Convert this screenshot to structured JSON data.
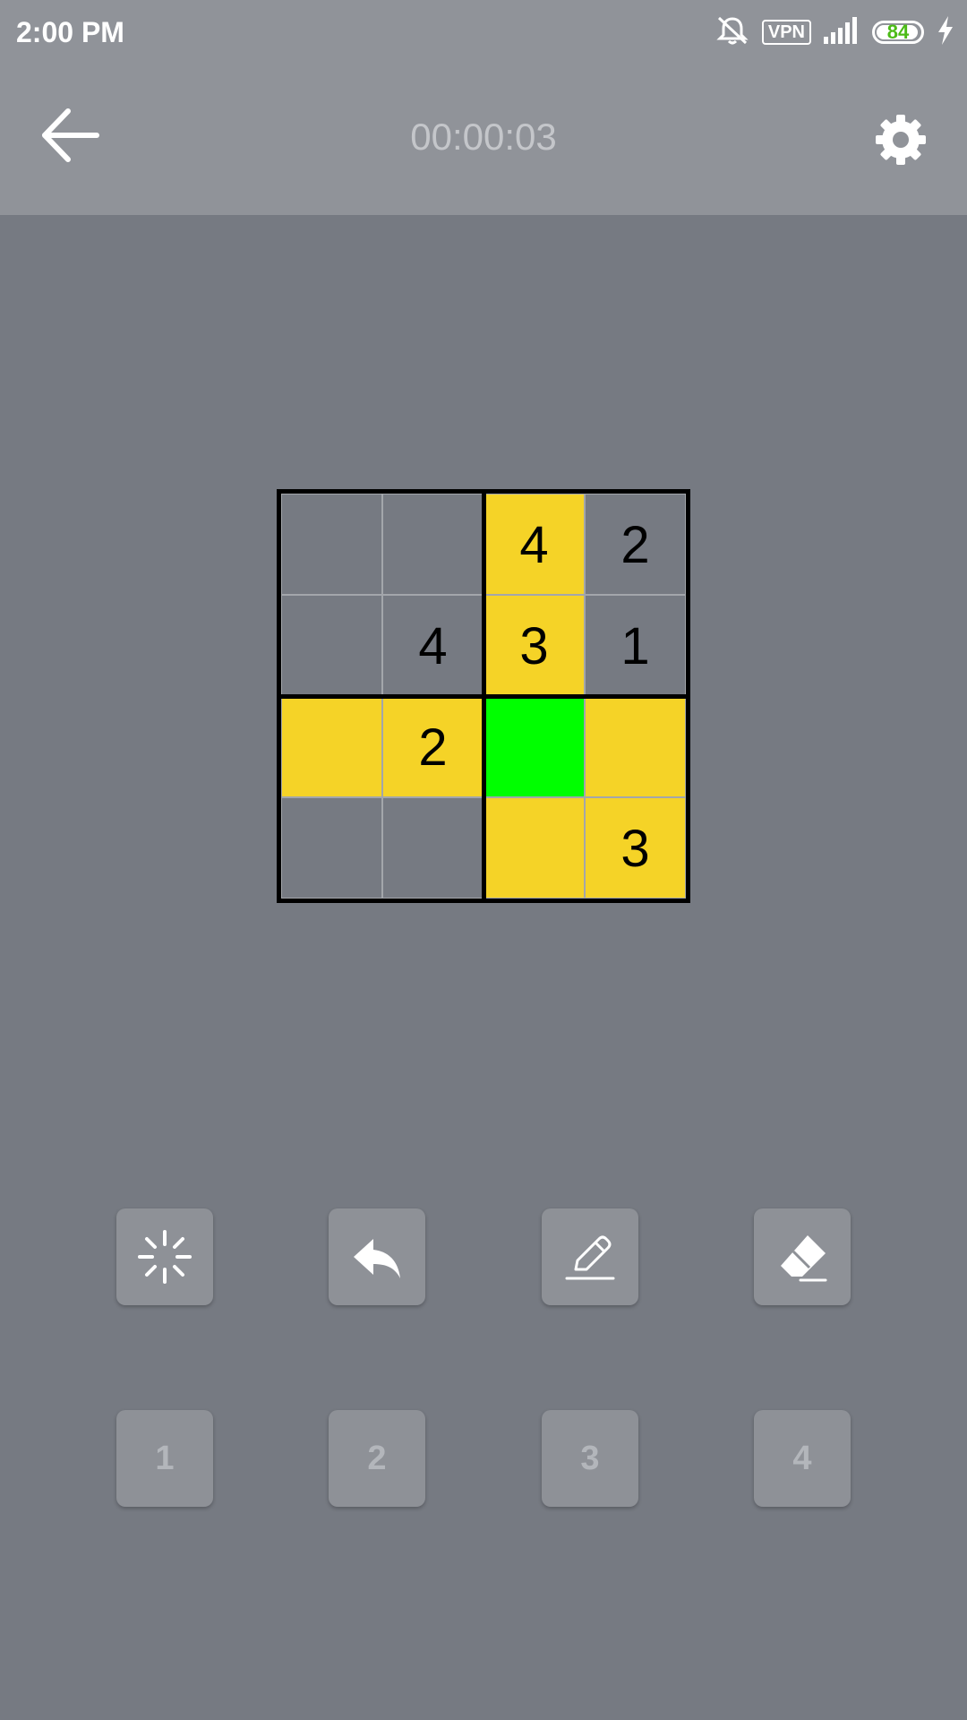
{
  "status_bar": {
    "time": "2:00 PM",
    "vpn_label": "VPN",
    "battery_level": "84",
    "icons": [
      "mute-icon",
      "vpn-icon",
      "signal-icon",
      "battery-icon",
      "charging-icon"
    ]
  },
  "toolbar": {
    "timer": "00:00:03",
    "back_icon": "arrow-left-icon",
    "settings_icon": "gear-icon"
  },
  "colors": {
    "background": "#767a82",
    "toolbar": "#909399",
    "highlight": "#f5d327",
    "selected": "#00ff00",
    "grid_line": "#000000"
  },
  "board": {
    "size": 4,
    "cells": [
      [
        "",
        "",
        "4",
        "2"
      ],
      [
        "",
        "4",
        "3",
        "1"
      ],
      [
        "",
        "2",
        "",
        ""
      ],
      [
        "",
        "",
        "",
        "3"
      ]
    ],
    "highlights": [
      [
        "none",
        "none",
        "yellow",
        "none"
      ],
      [
        "none",
        "none",
        "yellow",
        "none"
      ],
      [
        "yellow",
        "yellow",
        "green",
        "yellow"
      ],
      [
        "none",
        "none",
        "yellow",
        "yellow"
      ]
    ],
    "selected_cell": {
      "row": 3,
      "col": 3
    }
  },
  "actions": [
    {
      "name": "hint-button",
      "icon": "hint-sparkle-icon"
    },
    {
      "name": "undo-button",
      "icon": "undo-icon"
    },
    {
      "name": "pencil-button",
      "icon": "pencil-icon"
    },
    {
      "name": "eraser-button",
      "icon": "eraser-icon"
    }
  ],
  "number_pad": [
    "1",
    "2",
    "3",
    "4"
  ]
}
